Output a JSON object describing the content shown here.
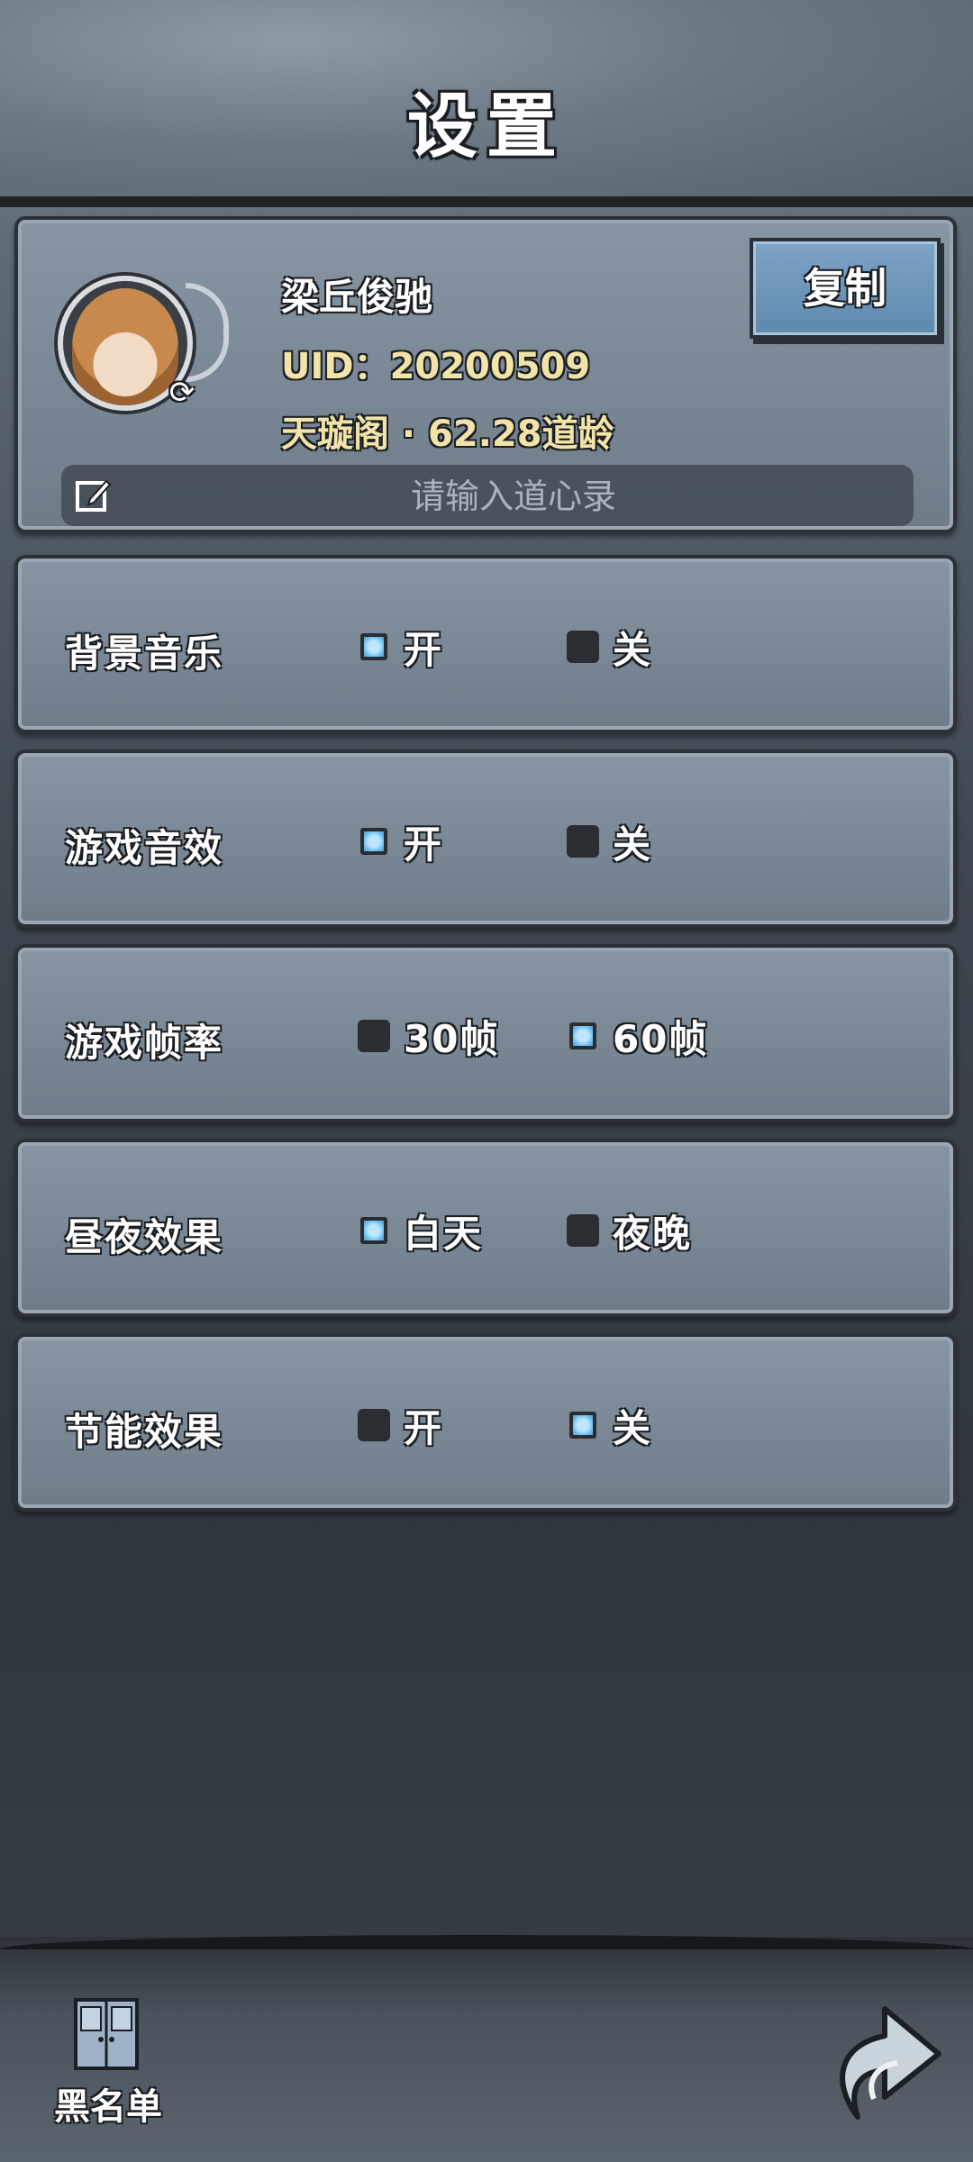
{
  "header": {
    "title": "设置"
  },
  "profile": {
    "nickname": "梁丘俊驰",
    "uid": "UID：20200509",
    "sect_age": "天璇阁 · 62.28道龄",
    "copy_label": "复制",
    "motto_placeholder": "请输入道心录"
  },
  "settings": [
    {
      "label": "背景音乐",
      "options": [
        {
          "label": "开",
          "selected": true
        },
        {
          "label": "关",
          "selected": false
        }
      ]
    },
    {
      "label": "游戏音效",
      "options": [
        {
          "label": "开",
          "selected": true
        },
        {
          "label": "关",
          "selected": false
        }
      ]
    },
    {
      "label": "游戏帧率",
      "options": [
        {
          "label": "30帧",
          "selected": false
        },
        {
          "label": "60帧",
          "selected": true
        }
      ]
    },
    {
      "label": "昼夜效果",
      "options": [
        {
          "label": "白天",
          "selected": true
        },
        {
          "label": "夜晚",
          "selected": false
        }
      ]
    },
    {
      "label": "节能效果",
      "options": [
        {
          "label": "开",
          "selected": false
        },
        {
          "label": "关",
          "selected": true
        }
      ]
    }
  ],
  "footer": {
    "blacklist_label": "黑名单"
  },
  "icons": {
    "avatar": "character-avatar",
    "refresh": "refresh-icon",
    "edit": "edit-icon",
    "blacklist": "door-icon",
    "back": "back-arrow-icon"
  },
  "colors": {
    "accent_checked": "#6fc2f2",
    "unchecked": "#2a2d31",
    "gold_text": "#f2e3a8",
    "copy_button": "#6d95b9"
  }
}
